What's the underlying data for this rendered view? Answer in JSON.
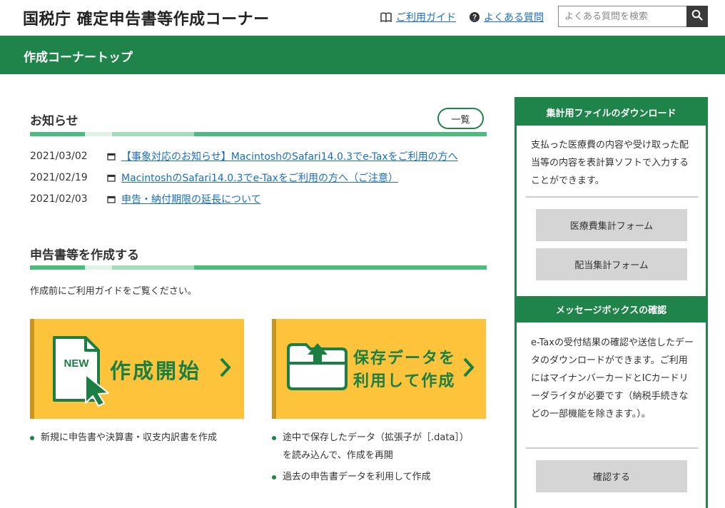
{
  "header": {
    "site_title": "国税庁 確定申告書等作成コーナー",
    "guide_link": "ご利用ガイド",
    "faq_link": "よくある質問",
    "search_placeholder": "よくある質問を検索"
  },
  "page_title": "作成コーナートップ",
  "news": {
    "title": "お知らせ",
    "list_button": "一覧",
    "items": [
      {
        "date": "2021/03/02",
        "text": "【事象対応のお知らせ】MacintoshのSafari14.0.3でe-Taxをご利用の方へ"
      },
      {
        "date": "2021/02/19",
        "text": "MacintoshのSafari14.0.3でe-Taxをご利用の方へ（ご注意）"
      },
      {
        "date": "2021/02/03",
        "text": "申告・納付期限の延長について"
      }
    ]
  },
  "create": {
    "title": "申告書等を作成する",
    "note": "作成前にご利用ガイドをご覧ください。",
    "new_card": {
      "badge": "NEW",
      "label": "作成開始",
      "bullets": [
        "新規に申告書や決算書・収支内訳書を作成"
      ]
    },
    "saved_card": {
      "label_line1": "保存データを",
      "label_line2": "利用して作成",
      "bullets_line1": "途中で保存したデータ（拡張子が［.data］）",
      "bullets_line2": "を読み込んで、作成を再開",
      "bullets_2": "過去の申告書データを利用して作成"
    }
  },
  "sidebar": {
    "download": {
      "title": "集計用ファイルのダウンロード",
      "text": "支払った医療費の内容や受け取った配当等の内容を表計算ソフトで入力することができます。",
      "btn_medical": "医療費集計フォーム",
      "btn_dividend": "配当集計フォーム"
    },
    "messagebox": {
      "title": "メッセージボックスの確認",
      "text": "e-Taxの受付結果の確認や送信したデータのダウンロードができます。ご利用にはマイナンバーカードとICカードリーダライタが必要です（納税手続きなどの一部機能を除きます。）。",
      "btn_check": "確認する"
    }
  },
  "colors": {
    "brand_green": "#1e8449",
    "card_yellow": "#fcc33b",
    "link_blue": "#1a6fc4"
  }
}
